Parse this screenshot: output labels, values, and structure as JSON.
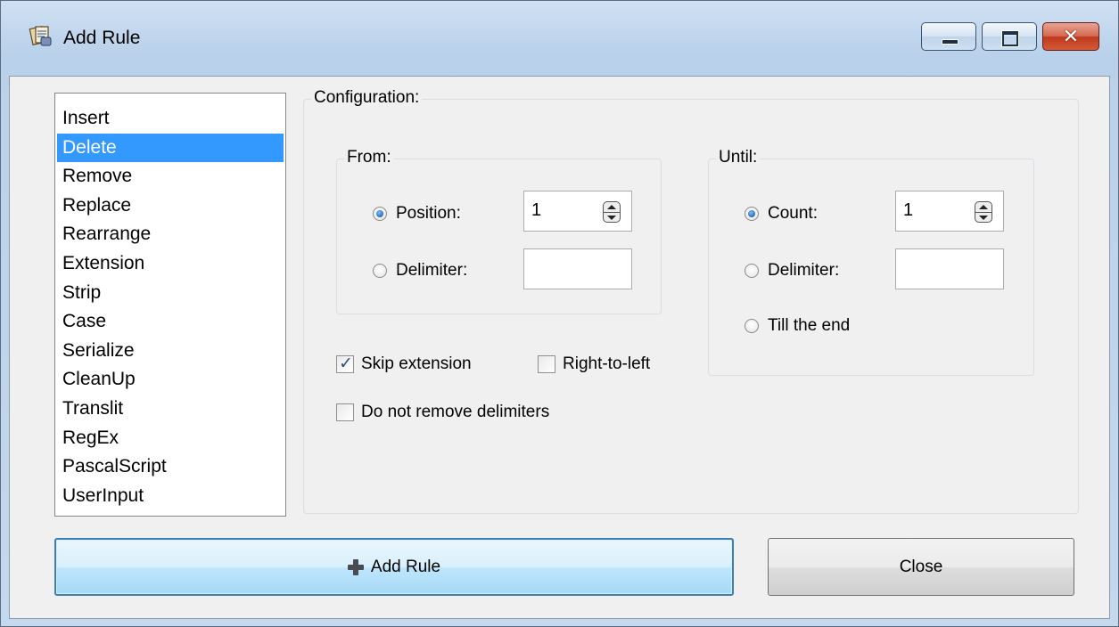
{
  "window": {
    "title": "Add Rule",
    "controls": {
      "minimize": "minimize",
      "maximize": "maximize",
      "close": "✕"
    }
  },
  "rule_list": {
    "items": [
      "Insert",
      "Delete",
      "Remove",
      "Replace",
      "Rearrange",
      "Extension",
      "Strip",
      "Case",
      "Serialize",
      "CleanUp",
      "Translit",
      "RegEx",
      "PascalScript",
      "UserInput"
    ],
    "selected": "Delete"
  },
  "configuration": {
    "label": "Configuration:",
    "from": {
      "label": "From:",
      "position_label": "Position:",
      "position_value": "1",
      "position_checked": true,
      "delimiter_label": "Delimiter:",
      "delimiter_value": ""
    },
    "until": {
      "label": "Until:",
      "count_label": "Count:",
      "count_value": "1",
      "count_checked": true,
      "delimiter_label": "Delimiter:",
      "delimiter_value": "",
      "till_end_label": "Till the end"
    },
    "skip_extension": {
      "label": "Skip extension",
      "checked": true
    },
    "right_to_left": {
      "label": "Right-to-left",
      "checked": false
    },
    "do_not_remove_delimiters": {
      "label": "Do not remove delimiters",
      "checked": false
    }
  },
  "buttons": {
    "add_rule_label": "Add Rule",
    "add_rule_icon": "plus-icon",
    "close_label": "Close"
  }
}
